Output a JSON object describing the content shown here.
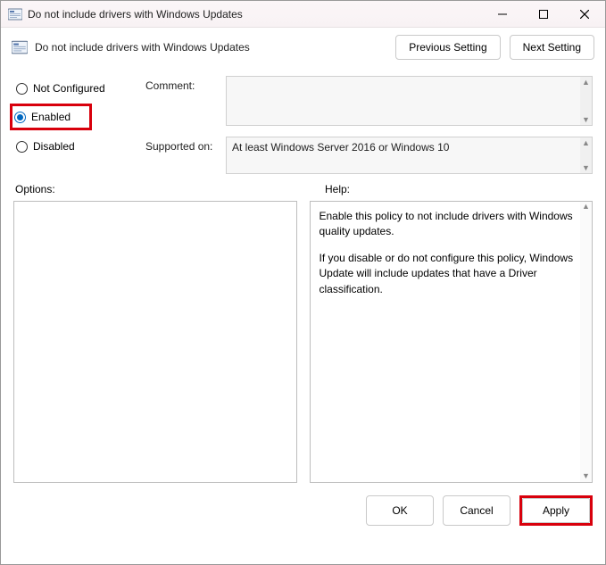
{
  "titlebar": {
    "title": "Do not include drivers with Windows Updates"
  },
  "header": {
    "title": "Do not include drivers with Windows Updates",
    "prev": "Previous Setting",
    "next": "Next Setting"
  },
  "state": {
    "not_configured": "Not Configured",
    "enabled": "Enabled",
    "disabled": "Disabled",
    "selected": "enabled"
  },
  "meta": {
    "comment_label": "Comment:",
    "comment_value": "",
    "supported_label": "Supported on:",
    "supported_value": "At least Windows Server 2016 or Windows 10"
  },
  "panes": {
    "options_label": "Options:",
    "help_label": "Help:",
    "help_p1": "Enable this policy to not include drivers with Windows quality updates.",
    "help_p2": "If you disable or do not configure this policy, Windows Update will include updates that have a Driver classification."
  },
  "footer": {
    "ok": "OK",
    "cancel": "Cancel",
    "apply": "Apply"
  }
}
